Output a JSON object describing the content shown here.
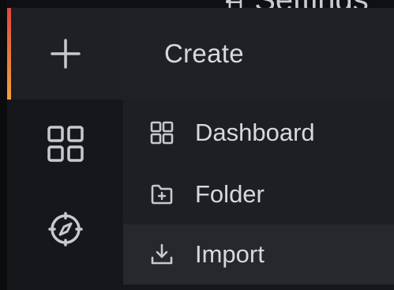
{
  "top_strip": {
    "text": "ਜ਼  Settings"
  },
  "sidebar": {
    "items": [
      {
        "name": "create",
        "icon": "plus-icon"
      },
      {
        "name": "dashboards",
        "icon": "apps-grid-icon"
      },
      {
        "name": "explore",
        "icon": "compass-icon"
      }
    ],
    "accent_colors": [
      "#e0483e",
      "#f2a33a"
    ]
  },
  "create_menu": {
    "title": "Create",
    "items": [
      {
        "label": "Dashboard",
        "icon": "apps-grid-icon"
      },
      {
        "label": "Folder",
        "icon": "folder-plus-icon"
      },
      {
        "label": "Import",
        "icon": "import-icon"
      }
    ]
  }
}
